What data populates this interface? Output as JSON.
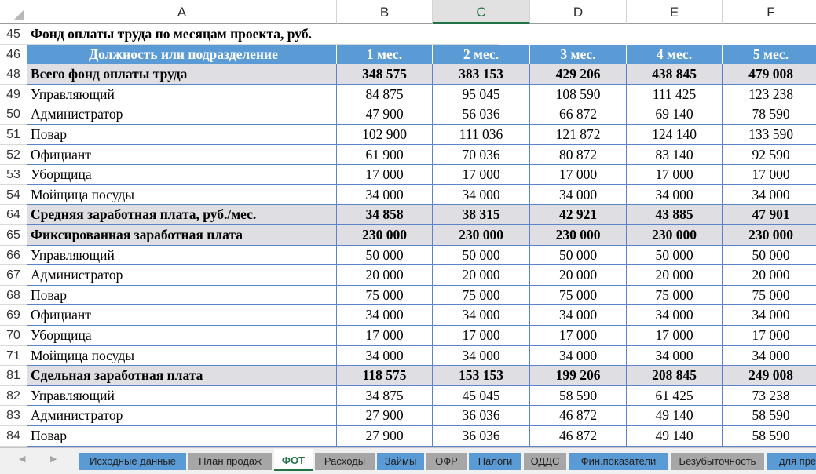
{
  "columns": [
    "A",
    "B",
    "C",
    "D",
    "E",
    "F"
  ],
  "selected_column": "C",
  "title_row": {
    "num": "45",
    "text": "Фонд оплаты труда по месяцам проекта, руб."
  },
  "header_row": {
    "num": "46",
    "cells": [
      "Должность или подразделение",
      "1 мес.",
      "2 мес.",
      "3 мес.",
      "4 мес.",
      "5 мес."
    ]
  },
  "rows": [
    {
      "num": "48",
      "style": "bold",
      "cells": [
        "Всего фонд оплаты труда",
        "348 575",
        "383 153",
        "429 206",
        "438 845",
        "479 008"
      ]
    },
    {
      "num": "49",
      "style": "bord",
      "cells": [
        "Управляющий",
        "84 875",
        "95 045",
        "108 590",
        "111 425",
        "123 238"
      ]
    },
    {
      "num": "50",
      "style": "bord",
      "cells": [
        "Администратор",
        "47 900",
        "56 036",
        "66 872",
        "69 140",
        "78 590"
      ]
    },
    {
      "num": "51",
      "style": "bord",
      "cells": [
        "Повар",
        "102 900",
        "111 036",
        "121 872",
        "124 140",
        "133 590"
      ]
    },
    {
      "num": "52",
      "style": "bord",
      "cells": [
        "Официант",
        "61 900",
        "70 036",
        "80 872",
        "83 140",
        "92 590"
      ]
    },
    {
      "num": "53",
      "style": "bord",
      "cells": [
        "Уборщица",
        "17 000",
        "17 000",
        "17 000",
        "17 000",
        "17 000"
      ]
    },
    {
      "num": "54",
      "style": "bord",
      "cells": [
        "Мойщица посуды",
        "34 000",
        "34 000",
        "34 000",
        "34 000",
        "34 000"
      ]
    },
    {
      "num": "64",
      "style": "bold",
      "cells": [
        "Средняя заработная плата, руб./мес.",
        "34 858",
        "38 315",
        "42 921",
        "43 885",
        "47 901"
      ]
    },
    {
      "num": "65",
      "style": "bold",
      "cells": [
        "Фиксированная заработная плата",
        "230 000",
        "230 000",
        "230 000",
        "230 000",
        "230 000"
      ]
    },
    {
      "num": "66",
      "style": "bord",
      "cells": [
        "Управляющий",
        "50 000",
        "50 000",
        "50 000",
        "50 000",
        "50 000"
      ]
    },
    {
      "num": "67",
      "style": "bord",
      "cells": [
        "Администратор",
        "20 000",
        "20 000",
        "20 000",
        "20 000",
        "20 000"
      ]
    },
    {
      "num": "68",
      "style": "bord",
      "cells": [
        "Повар",
        "75 000",
        "75 000",
        "75 000",
        "75 000",
        "75 000"
      ]
    },
    {
      "num": "69",
      "style": "bord",
      "cells": [
        "Официант",
        "34 000",
        "34 000",
        "34 000",
        "34 000",
        "34 000"
      ]
    },
    {
      "num": "70",
      "style": "bord",
      "cells": [
        "Уборщица",
        "17 000",
        "17 000",
        "17 000",
        "17 000",
        "17 000"
      ]
    },
    {
      "num": "71",
      "style": "bord",
      "cells": [
        "Мойщица посуды",
        "34 000",
        "34 000",
        "34 000",
        "34 000",
        "34 000"
      ]
    },
    {
      "num": "81",
      "style": "bold",
      "cells": [
        "Сдельная заработная плата",
        "118 575",
        "153 153",
        "199 206",
        "208 845",
        "249 008"
      ]
    },
    {
      "num": "82",
      "style": "bord",
      "cells": [
        "Управляющий",
        "34 875",
        "45 045",
        "58 590",
        "61 425",
        "73 238"
      ]
    },
    {
      "num": "83",
      "style": "bord",
      "cells": [
        "Администратор",
        "27 900",
        "36 036",
        "46 872",
        "49 140",
        "58 590"
      ]
    },
    {
      "num": "84",
      "style": "bord",
      "cells": [
        "Повар",
        "27 900",
        "36 036",
        "46 872",
        "49 140",
        "58 590"
      ]
    }
  ],
  "sheet_tabs": [
    {
      "label": "Исходные данные",
      "color": "blue"
    },
    {
      "label": "План продаж",
      "color": "gray"
    },
    {
      "label": "ФОТ",
      "color": "active"
    },
    {
      "label": "Расходы",
      "color": "gray"
    },
    {
      "label": "Займы",
      "color": "blue"
    },
    {
      "label": "ОФР",
      "color": "gray"
    },
    {
      "label": "Налоги",
      "color": "blue"
    },
    {
      "label": "ОДДС",
      "color": "gray"
    },
    {
      "label": "Фин.показатели",
      "color": "blue"
    },
    {
      "label": "Безубыточность",
      "color": "gray"
    },
    {
      "label": "для пре",
      "color": "blue"
    }
  ],
  "nav_icons": [
    "scroll-left-icon",
    "scroll-right-icon"
  ]
}
